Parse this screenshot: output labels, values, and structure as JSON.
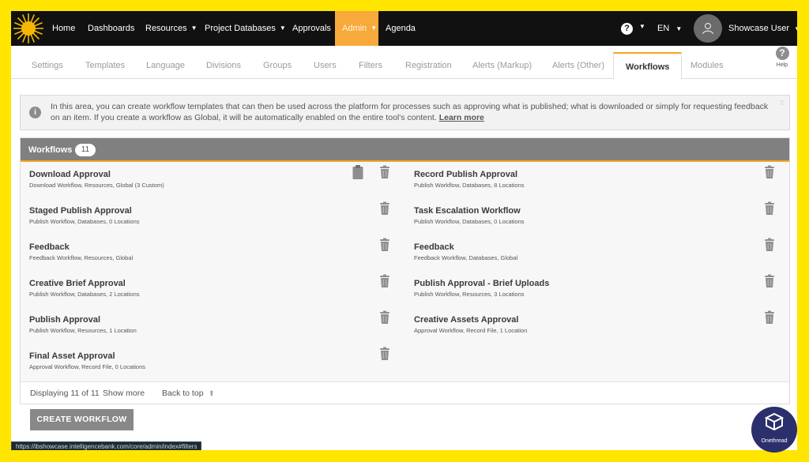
{
  "nav": {
    "items": [
      {
        "label": "Home",
        "caret": false
      },
      {
        "label": "Dashboards",
        "caret": false
      },
      {
        "label": "Resources",
        "caret": true
      },
      {
        "label": "Project Databases",
        "caret": true
      },
      {
        "label": "Approvals",
        "caret": false
      },
      {
        "label": "Admin",
        "caret": true,
        "active": true
      },
      {
        "label": "Agenda",
        "caret": false
      }
    ],
    "language": "EN",
    "user_name": "Showcase User"
  },
  "tabs": [
    {
      "label": "Settings"
    },
    {
      "label": "Templates"
    },
    {
      "label": "Language"
    },
    {
      "label": "Divisions"
    },
    {
      "label": "Groups"
    },
    {
      "label": "Users"
    },
    {
      "label": "Filters"
    },
    {
      "label": "Registration"
    },
    {
      "label": "Alerts (Markup)"
    },
    {
      "label": "Alerts (Other)"
    },
    {
      "label": "Workflows",
      "active": true
    },
    {
      "label": "Modules"
    }
  ],
  "help_label": "Help",
  "info": {
    "text": "In this area, you can create workflow templates that can then be used across the platform for processes such as approving what is published; what is downloaded or simply for requesting feedback on an item. If you create a workflow as Global, it will be automatically enabled on the entire tool's content. ",
    "link": "Learn more"
  },
  "panel": {
    "title": "Workflows",
    "count": "11",
    "left": [
      {
        "name": "Download Approval",
        "desc": "Download Workflow, Resources, Global (3 Custom)",
        "clipboard": true
      },
      {
        "name": "Staged Publish Approval",
        "desc": "Publish Workflow, Databases, 0 Locations"
      },
      {
        "name": "Feedback",
        "desc": "Feedback Workflow, Resources, Global"
      },
      {
        "name": "Creative Brief Approval",
        "desc": "Publish Workflow, Databases, 2 Locations"
      },
      {
        "name": "Publish Approval",
        "desc": "Publish Workflow, Resources, 1 Location"
      },
      {
        "name": "Final Asset Approval",
        "desc": "Approval Workflow, Record File, 0 Locations"
      }
    ],
    "right": [
      {
        "name": "Record Publish Approval",
        "desc": "Publish Workflow, Databases, 8 Locations"
      },
      {
        "name": "Task Escalation Workflow",
        "desc": "Publish Workflow, Databases, 0 Locations"
      },
      {
        "name": "Feedback",
        "desc": "Feedback Workflow, Databases, Global"
      },
      {
        "name": "Publish Approval - Brief Uploads",
        "desc": "Publish Workflow, Resources, 3 Locations"
      },
      {
        "name": "Creative Assets Approval",
        "desc": "Approval Workflow, Record File, 1 Location"
      }
    ],
    "footer": {
      "displaying": "Displaying 11 of 11",
      "show_more": "Show more",
      "back_to_top": "Back to top"
    }
  },
  "create_button": "CREATE WORKFLOW",
  "status_url": "https://ibshowcase.intelligencebank.com/core/admin/index#filters",
  "watermark": "Onethread",
  "colors": {
    "accent": "#f5a623",
    "nav_bg": "#111111",
    "active_nav": "#f7a93b",
    "panel_header": "#808080",
    "frame": "#ffe500"
  }
}
